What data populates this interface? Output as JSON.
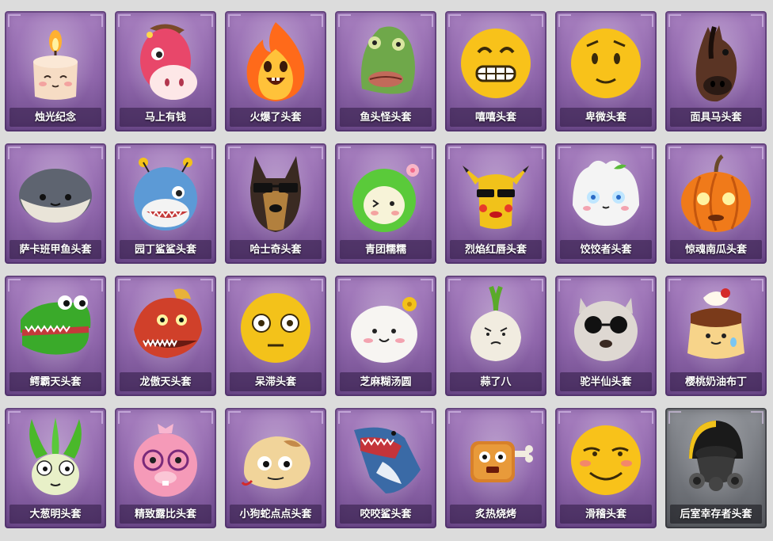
{
  "items": [
    {
      "name": "烛光纪念",
      "icon": "candle-icon",
      "rarity_color": "#9067ac"
    },
    {
      "name": "马上有钱",
      "icon": "pink-horse-icon",
      "rarity_color": "#9067ac"
    },
    {
      "name": "火爆了头套",
      "icon": "fire-icon",
      "rarity_color": "#9067ac"
    },
    {
      "name": "鱼头怪头套",
      "icon": "fish-head-icon",
      "rarity_color": "#9067ac"
    },
    {
      "name": "嘻嘻头套",
      "icon": "grin-emoji-icon",
      "rarity_color": "#9067ac"
    },
    {
      "name": "卑微头套",
      "icon": "humble-emoji-icon",
      "rarity_color": "#9067ac"
    },
    {
      "name": "面具马头套",
      "icon": "horse-mask-icon",
      "rarity_color": "#9067ac"
    },
    {
      "name": "萨卡班甲鱼头套",
      "icon": "sacabambaspis-icon",
      "rarity_color": "#9067ac"
    },
    {
      "name": "园丁鲨鲨头套",
      "icon": "shark-gardener-icon",
      "rarity_color": "#9067ac"
    },
    {
      "name": "哈士奇头套",
      "icon": "husky-icon",
      "rarity_color": "#9067ac"
    },
    {
      "name": "青团糯糯",
      "icon": "qingtuan-icon",
      "rarity_color": "#9067ac"
    },
    {
      "name": "烈焰红唇头套",
      "icon": "red-lips-pikachu-icon",
      "rarity_color": "#9067ac"
    },
    {
      "name": "饺饺者头套",
      "icon": "dumpling-icon",
      "rarity_color": "#9067ac"
    },
    {
      "name": "惊魂南瓜头套",
      "icon": "pumpkin-icon",
      "rarity_color": "#9067ac"
    },
    {
      "name": "鳄霸天头套",
      "icon": "crocodile-icon",
      "rarity_color": "#9067ac"
    },
    {
      "name": "龙傲天头套",
      "icon": "dragon-icon",
      "rarity_color": "#9067ac"
    },
    {
      "name": "呆滞头套",
      "icon": "dazed-emoji-icon",
      "rarity_color": "#9067ac"
    },
    {
      "name": "芝麻糊汤圆",
      "icon": "tangyuan-icon",
      "rarity_color": "#9067ac"
    },
    {
      "name": "蒜了八",
      "icon": "garlic-icon",
      "rarity_color": "#9067ac"
    },
    {
      "name": "驼半仙头套",
      "icon": "alpaca-icon",
      "rarity_color": "#9067ac"
    },
    {
      "name": "樱桃奶油布丁",
      "icon": "pudding-icon",
      "rarity_color": "#9067ac"
    },
    {
      "name": "大葱明头套",
      "icon": "scallion-icon",
      "rarity_color": "#9067ac"
    },
    {
      "name": "精致露比头套",
      "icon": "loopy-icon",
      "rarity_color": "#9067ac"
    },
    {
      "name": "小狗蛇点点头套",
      "icon": "snake-icon",
      "rarity_color": "#9067ac"
    },
    {
      "name": "咬咬鲨头套",
      "icon": "biting-shark-icon",
      "rarity_color": "#9067ac"
    },
    {
      "name": "炙热烧烤",
      "icon": "bbq-meat-icon",
      "rarity_color": "#9067ac"
    },
    {
      "name": "滑稽头套",
      "icon": "funny-emoji-icon",
      "rarity_color": "#9067ac"
    },
    {
      "name": "后室幸存者头套",
      "icon": "gas-mask-helmet-icon",
      "rarity_color": "#74777d"
    }
  ]
}
